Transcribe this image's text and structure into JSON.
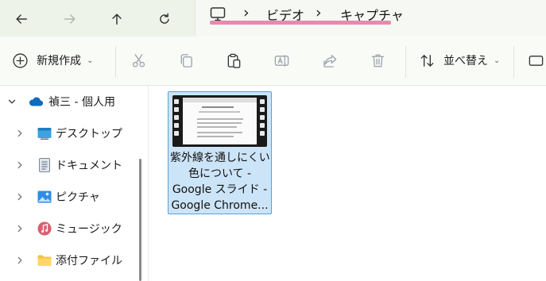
{
  "nav": {
    "back": "back-arrow-icon",
    "forward": "forward-arrow-icon",
    "up": "up-arrow-icon",
    "refresh": "refresh-icon"
  },
  "breadcrumb": {
    "root_icon": "monitor-icon",
    "separator": "›",
    "items": [
      "ビデオ",
      "キャプチャ"
    ],
    "highlight_color": "#e58ab0"
  },
  "toolbar": {
    "new_label": "新規作成",
    "sort_label": "並べ替え",
    "icons": [
      "plus-icon",
      "cut-icon",
      "copy-icon",
      "paste-icon",
      "rename-icon",
      "share-icon",
      "delete-icon",
      "sort-icon",
      "view-icon"
    ]
  },
  "sidebar": {
    "items": [
      {
        "label": "禎三 - 個人用",
        "icon": "onedrive-cloud-icon",
        "expanded": true
      },
      {
        "label": "デスクトップ",
        "icon": "desktop-folder-icon",
        "expanded": false
      },
      {
        "label": "ドキュメント",
        "icon": "documents-folder-icon",
        "expanded": false
      },
      {
        "label": "ピクチャ",
        "icon": "pictures-folder-icon",
        "expanded": false
      },
      {
        "label": "ミュージック",
        "icon": "music-folder-icon",
        "expanded": false
      },
      {
        "label": "添付ファイル",
        "icon": "folder-icon",
        "expanded": false
      }
    ]
  },
  "files": [
    {
      "name_lines": [
        "紫外線を通しにくい",
        "色について -",
        "Google スライド -",
        "Google Chrome..."
      ],
      "type": "video",
      "selected": true
    }
  ],
  "colors": {
    "selection_bg": "#cce4f7",
    "selection_border": "#5a9fd4",
    "nav_bg": "#eef3ea",
    "onedrive": "#0f6cbd"
  }
}
